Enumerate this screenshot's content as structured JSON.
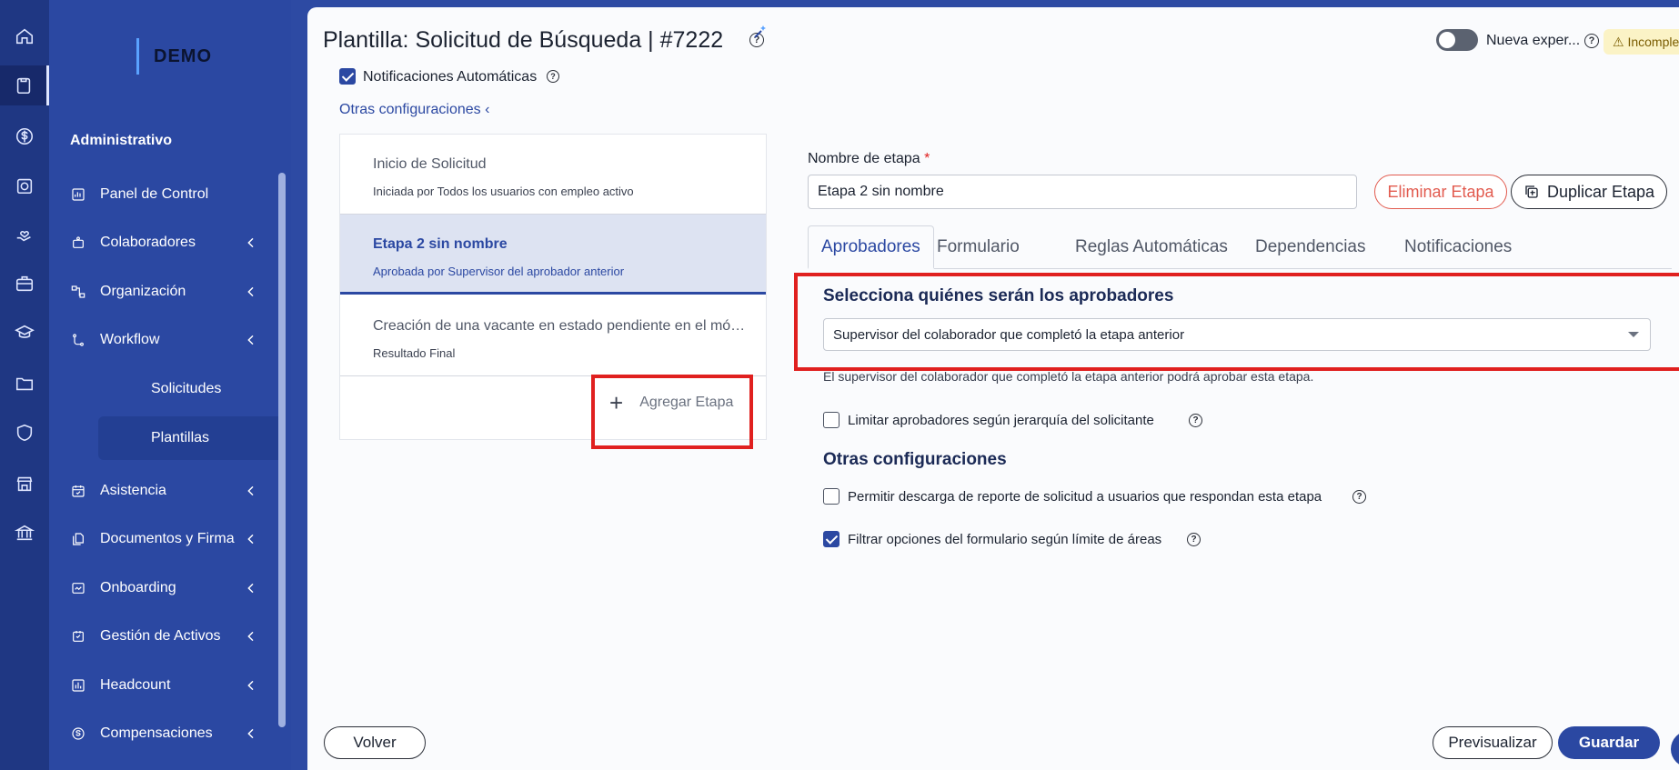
{
  "sidebar": {
    "logo_text": "DEMO",
    "section_title": "Administrativo",
    "items": [
      {
        "label": "Panel de Control"
      },
      {
        "label": "Colaboradores"
      },
      {
        "label": "Organización"
      },
      {
        "label": "Workflow"
      },
      {
        "label": "Solicitudes"
      },
      {
        "label": "Plantillas"
      },
      {
        "label": "Asistencia"
      },
      {
        "label": "Documentos y Firma"
      },
      {
        "label": "Onboarding"
      },
      {
        "label": "Gestión de Activos"
      },
      {
        "label": "Headcount"
      },
      {
        "label": "Compensaciones"
      }
    ]
  },
  "header": {
    "title": "Plantilla: Solicitud de Búsqueda | #7222",
    "toggle_label": "Nueva exper...",
    "status_badge": "⚠ Incomple"
  },
  "config": {
    "notifications_label": "Notificaciones Automáticas",
    "other_settings_link": "Otras configuraciones"
  },
  "stages": [
    {
      "title": "Inicio de Solicitud",
      "subtitle": "Iniciada por Todos los usuarios con empleo activo"
    },
    {
      "title": "Etapa 2 sin nombre",
      "subtitle": "Aprobada por Supervisor del aprobador anterior"
    },
    {
      "title": "Creación de una vacante en estado pendiente en el módulo de Reclutamiento",
      "subtitle": "Resultado Final"
    }
  ],
  "add_stage_label": "Agregar Etapa",
  "stage_form": {
    "name_label": "Nombre de etapa",
    "name_required": "*",
    "name_value": "Etapa 2 sin nombre",
    "delete_button": "Eliminar Etapa",
    "duplicate_button": "Duplicar Etapa"
  },
  "tabs": [
    "Aprobadores",
    "Formulario",
    "Reglas Automáticas",
    "Dependencias",
    "Notificaciones"
  ],
  "approvers": {
    "title": "Selecciona quiénes serán los aprobadores",
    "selected": "Supervisor del colaborador que completó la etapa anterior",
    "helper": "El supervisor del colaborador que completó la etapa anterior podrá aprobar esta etapa.",
    "limit_label": "Limitar aprobadores según jerarquía del solicitante"
  },
  "other_config": {
    "title": "Otras configuraciones",
    "download_label": "Permitir descarga de reporte de solicitud a usuarios que respondan esta etapa",
    "filter_label": "Filtrar opciones del formulario según límite de áreas"
  },
  "footer": {
    "back": "Volver",
    "preview": "Previsualizar",
    "save": "Guardar"
  }
}
